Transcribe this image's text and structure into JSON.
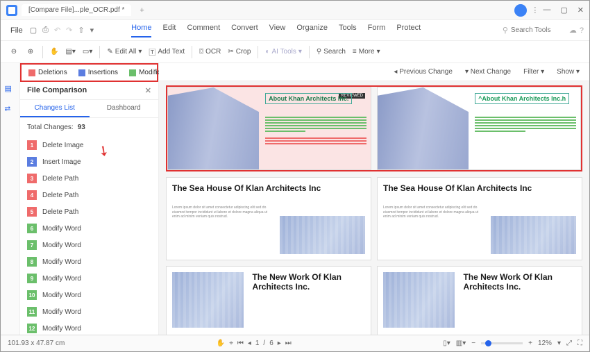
{
  "title": "[Compare File]...ple_OCR.pdf *",
  "menu": {
    "file": "File"
  },
  "menutabs": [
    "Home",
    "Edit",
    "Comment",
    "Convert",
    "View",
    "Organize",
    "Tools",
    "Form",
    "Protect"
  ],
  "search_placeholder": "Search Tools",
  "toolbar": {
    "edit_all": "Edit All",
    "add_text": "Add Text",
    "ocr": "OCR",
    "crop": "Crop",
    "ai_tools": "AI Tools",
    "search": "Search",
    "more": "More"
  },
  "legend": {
    "del": "Deletions",
    "ins": "Insertions",
    "mod": "Modifications"
  },
  "compare_bar": {
    "prev": "Previous Change",
    "next": "Next Change",
    "filter": "Filter",
    "show": "Show"
  },
  "panel": {
    "title": "File Comparison",
    "tabs": {
      "changes": "Changes List",
      "dashboard": "Dashboard"
    },
    "total_label": "Total Changes:",
    "total_value": "93",
    "items": [
      {
        "n": "1",
        "t": "del",
        "label": "Delete Image"
      },
      {
        "n": "2",
        "t": "ins",
        "label": "Insert Image"
      },
      {
        "n": "3",
        "t": "del",
        "label": "Delete Path"
      },
      {
        "n": "4",
        "t": "del",
        "label": "Delete Path"
      },
      {
        "n": "5",
        "t": "del",
        "label": "Delete Path"
      },
      {
        "n": "6",
        "t": "mod",
        "label": "Modify Word"
      },
      {
        "n": "7",
        "t": "mod",
        "label": "Modify Word"
      },
      {
        "n": "8",
        "t": "mod",
        "label": "Modify Word"
      },
      {
        "n": "9",
        "t": "mod",
        "label": "Modify Word"
      },
      {
        "n": "10",
        "t": "mod",
        "label": "Modify Word"
      },
      {
        "n": "11",
        "t": "mod",
        "label": "Modify Word"
      },
      {
        "n": "12",
        "t": "mod",
        "label": "Modify Word"
      }
    ]
  },
  "pages": {
    "hero_left": "About Khan Architects Inc.",
    "hero_right": "^About Khan Architects Inc.h",
    "sec2": "The Sea House Of Klan Architects Inc",
    "sec3": "The New Work Of Klan Architects Inc.",
    "badge": "REVIEWED"
  },
  "status": {
    "coords": "101.93 x 47.87 cm",
    "page_cur": "1",
    "page_total": "6",
    "zoom": "12%"
  },
  "colors": {
    "del": "#ef6b6b",
    "ins": "#5b7de0",
    "mod": "#6bbf6b",
    "accent": "#2563eb",
    "hl": "#e03131"
  }
}
